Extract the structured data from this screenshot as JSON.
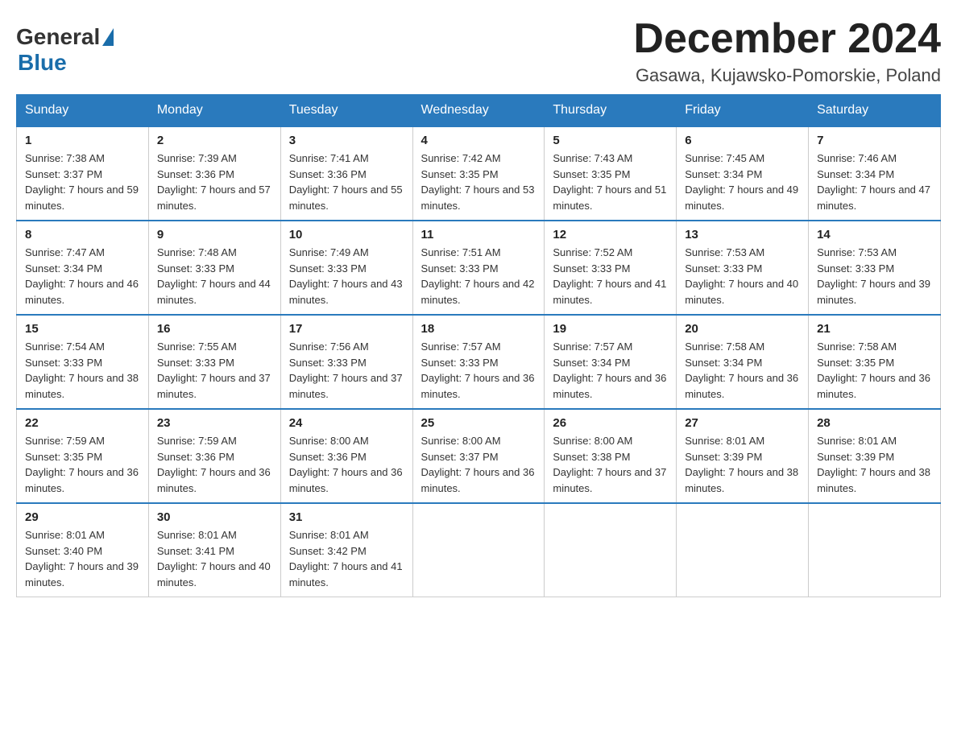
{
  "header": {
    "logo_general": "General",
    "logo_blue": "Blue",
    "month_title": "December 2024",
    "location": "Gasawa, Kujawsko-Pomorskie, Poland"
  },
  "weekdays": [
    "Sunday",
    "Monday",
    "Tuesday",
    "Wednesday",
    "Thursday",
    "Friday",
    "Saturday"
  ],
  "weeks": [
    [
      {
        "day": "1",
        "sunrise": "7:38 AM",
        "sunset": "3:37 PM",
        "daylight": "7 hours and 59 minutes."
      },
      {
        "day": "2",
        "sunrise": "7:39 AM",
        "sunset": "3:36 PM",
        "daylight": "7 hours and 57 minutes."
      },
      {
        "day": "3",
        "sunrise": "7:41 AM",
        "sunset": "3:36 PM",
        "daylight": "7 hours and 55 minutes."
      },
      {
        "day": "4",
        "sunrise": "7:42 AM",
        "sunset": "3:35 PM",
        "daylight": "7 hours and 53 minutes."
      },
      {
        "day": "5",
        "sunrise": "7:43 AM",
        "sunset": "3:35 PM",
        "daylight": "7 hours and 51 minutes."
      },
      {
        "day": "6",
        "sunrise": "7:45 AM",
        "sunset": "3:34 PM",
        "daylight": "7 hours and 49 minutes."
      },
      {
        "day": "7",
        "sunrise": "7:46 AM",
        "sunset": "3:34 PM",
        "daylight": "7 hours and 47 minutes."
      }
    ],
    [
      {
        "day": "8",
        "sunrise": "7:47 AM",
        "sunset": "3:34 PM",
        "daylight": "7 hours and 46 minutes."
      },
      {
        "day": "9",
        "sunrise": "7:48 AM",
        "sunset": "3:33 PM",
        "daylight": "7 hours and 44 minutes."
      },
      {
        "day": "10",
        "sunrise": "7:49 AM",
        "sunset": "3:33 PM",
        "daylight": "7 hours and 43 minutes."
      },
      {
        "day": "11",
        "sunrise": "7:51 AM",
        "sunset": "3:33 PM",
        "daylight": "7 hours and 42 minutes."
      },
      {
        "day": "12",
        "sunrise": "7:52 AM",
        "sunset": "3:33 PM",
        "daylight": "7 hours and 41 minutes."
      },
      {
        "day": "13",
        "sunrise": "7:53 AM",
        "sunset": "3:33 PM",
        "daylight": "7 hours and 40 minutes."
      },
      {
        "day": "14",
        "sunrise": "7:53 AM",
        "sunset": "3:33 PM",
        "daylight": "7 hours and 39 minutes."
      }
    ],
    [
      {
        "day": "15",
        "sunrise": "7:54 AM",
        "sunset": "3:33 PM",
        "daylight": "7 hours and 38 minutes."
      },
      {
        "day": "16",
        "sunrise": "7:55 AM",
        "sunset": "3:33 PM",
        "daylight": "7 hours and 37 minutes."
      },
      {
        "day": "17",
        "sunrise": "7:56 AM",
        "sunset": "3:33 PM",
        "daylight": "7 hours and 37 minutes."
      },
      {
        "day": "18",
        "sunrise": "7:57 AM",
        "sunset": "3:33 PM",
        "daylight": "7 hours and 36 minutes."
      },
      {
        "day": "19",
        "sunrise": "7:57 AM",
        "sunset": "3:34 PM",
        "daylight": "7 hours and 36 minutes."
      },
      {
        "day": "20",
        "sunrise": "7:58 AM",
        "sunset": "3:34 PM",
        "daylight": "7 hours and 36 minutes."
      },
      {
        "day": "21",
        "sunrise": "7:58 AM",
        "sunset": "3:35 PM",
        "daylight": "7 hours and 36 minutes."
      }
    ],
    [
      {
        "day": "22",
        "sunrise": "7:59 AM",
        "sunset": "3:35 PM",
        "daylight": "7 hours and 36 minutes."
      },
      {
        "day": "23",
        "sunrise": "7:59 AM",
        "sunset": "3:36 PM",
        "daylight": "7 hours and 36 minutes."
      },
      {
        "day": "24",
        "sunrise": "8:00 AM",
        "sunset": "3:36 PM",
        "daylight": "7 hours and 36 minutes."
      },
      {
        "day": "25",
        "sunrise": "8:00 AM",
        "sunset": "3:37 PM",
        "daylight": "7 hours and 36 minutes."
      },
      {
        "day": "26",
        "sunrise": "8:00 AM",
        "sunset": "3:38 PM",
        "daylight": "7 hours and 37 minutes."
      },
      {
        "day": "27",
        "sunrise": "8:01 AM",
        "sunset": "3:39 PM",
        "daylight": "7 hours and 38 minutes."
      },
      {
        "day": "28",
        "sunrise": "8:01 AM",
        "sunset": "3:39 PM",
        "daylight": "7 hours and 38 minutes."
      }
    ],
    [
      {
        "day": "29",
        "sunrise": "8:01 AM",
        "sunset": "3:40 PM",
        "daylight": "7 hours and 39 minutes."
      },
      {
        "day": "30",
        "sunrise": "8:01 AM",
        "sunset": "3:41 PM",
        "daylight": "7 hours and 40 minutes."
      },
      {
        "day": "31",
        "sunrise": "8:01 AM",
        "sunset": "3:42 PM",
        "daylight": "7 hours and 41 minutes."
      },
      null,
      null,
      null,
      null
    ]
  ]
}
